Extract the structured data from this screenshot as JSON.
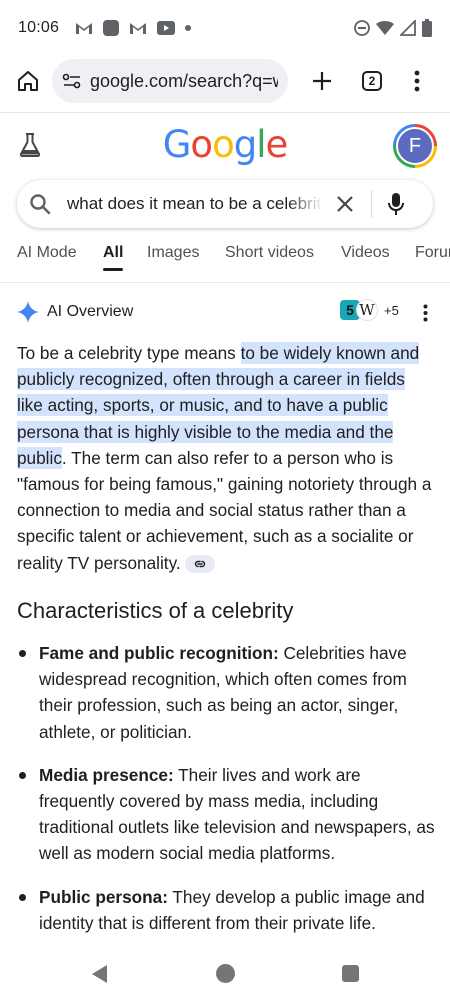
{
  "status": {
    "time": "10:06"
  },
  "browser": {
    "url": "google.com/search?q=w",
    "tab_count": "2"
  },
  "google": {
    "logo": "Google",
    "avatar_letter": "F"
  },
  "search": {
    "query": "what does it mean to be a celebrity"
  },
  "tabs": [
    "AI Mode",
    "All",
    "Images",
    "Short videos",
    "Videos",
    "Forums"
  ],
  "active_tab": "All",
  "ai_overview": {
    "label": "AI Overview",
    "source_badge": "5",
    "source_w": "W",
    "source_more": "+5",
    "para_pre": "To be a celebrity type means ",
    "para_highlight": "to be widely known and publicly recognized, often through a career in fields like acting, sports, or music, and to have a public persona that is highly visible to the media and the public",
    "para_post": ". The term can also refer to a person who is \"famous for being famous,\" gaining notoriety through a connection to media and social status rather than a specific talent or achievement, such as a socialite or reality TV personality."
  },
  "characteristics": {
    "heading": "Characteristics of a celebrity",
    "items": [
      {
        "title": "Fame and public recognition:",
        "text": " Celebrities have widespread recognition, which often comes from their profession, such as being an actor, singer, athlete, or politician."
      },
      {
        "title": "Media presence:",
        "text": " Their lives and work are frequently covered by mass media, including traditional outlets like television and newspapers, as well as modern social media platforms."
      },
      {
        "title": "Public persona:",
        "text": " They develop a public image and identity that is different from their private life."
      }
    ]
  },
  "colors": {
    "highlight": "#d3e3fd",
    "ai_star": "#4285f4",
    "avatar": "#5c6bc0"
  }
}
